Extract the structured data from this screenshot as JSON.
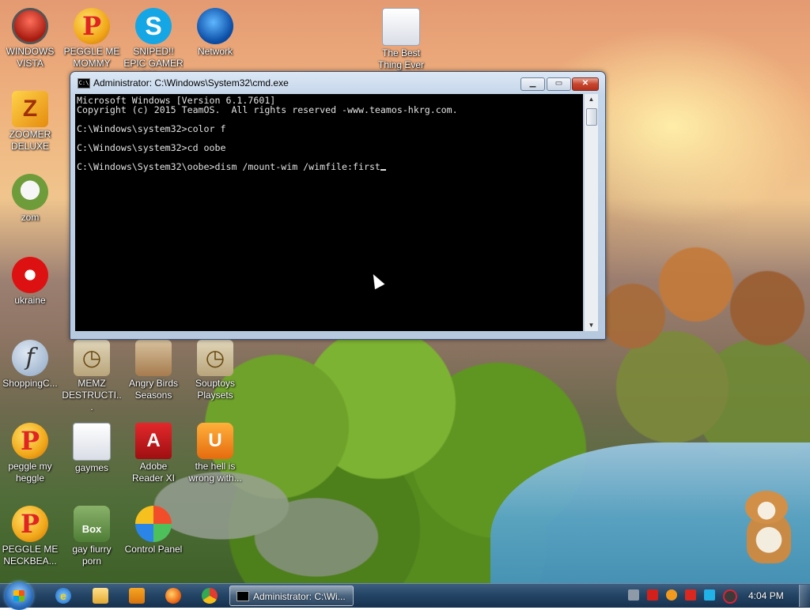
{
  "desktop_icons": [
    {
      "label": "WINDOWS VISTA",
      "icon": "vista-icon"
    },
    {
      "label": "PEGGLE ME MOMMY",
      "icon": "peggle-icon"
    },
    {
      "label": "SNIPED!! EPIC GAMER 360...",
      "icon": "skype-icon"
    },
    {
      "label": "Network",
      "icon": "network-icon"
    },
    {
      "label": "The Best Thing Ever",
      "icon": "folder-icon"
    },
    {
      "label": "ZOOMER DELUXE",
      "icon": "zoomer-icon"
    },
    {
      "label": "zom",
      "icon": "zom-icon"
    },
    {
      "label": "ukraine",
      "icon": "radiation-icon"
    },
    {
      "label": "ShoppingC...",
      "icon": "flash-icon"
    },
    {
      "label": "MEMZ DESTRUCTI...",
      "icon": "clock-icon"
    },
    {
      "label": "Angry Birds Seasons",
      "icon": "angry-birds-icon"
    },
    {
      "label": "Souptoys Playsets",
      "icon": "clock-icon"
    },
    {
      "label": "peggle my heggle",
      "icon": "peggle-icon"
    },
    {
      "label": "gaymes",
      "icon": "folder-icon"
    },
    {
      "label": "Adobe Reader XI",
      "icon": "pdf-icon"
    },
    {
      "label": "the hell is wrong with...",
      "icon": "uc-browser-icon"
    },
    {
      "label": "PEGGLE ME NECKBEA...",
      "icon": "peggle-icon"
    },
    {
      "label": "gay fiurry porn",
      "icon": "box-icon"
    },
    {
      "label": "Control Panel",
      "icon": "control-panel-icon"
    }
  ],
  "window": {
    "title": "Administrator: C:\\Windows\\System32\\cmd.exe",
    "title_icon_text": "C:\\",
    "console_lines": [
      "Microsoft Windows [Version 6.1.7601]",
      "Copyright (c) 2015 TeamOS.  All rights reserved -www.teamos-hkrg.com.",
      "",
      "C:\\Windows\\system32>color f",
      "",
      "C:\\Windows\\system32>cd oobe",
      "",
      "C:\\Windows\\System32\\oobe>dism /mount-wim /wimfile:first"
    ],
    "buttons": {
      "minimize": "minimize-icon",
      "maximize": "maximize-icon",
      "close": "close-icon"
    }
  },
  "taskbar": {
    "pinned": [
      "internet-explorer-icon",
      "folder-icon",
      "media-player-icon",
      "firefox-icon",
      "chrome-icon"
    ],
    "active_task": "Administrator: C:\\Wi...",
    "tray_icons": [
      "settings-icon",
      "antivirus-icon",
      "search-icon",
      "flag-icon",
      "display-icon",
      "speaker-icon"
    ],
    "clock": "4:04 PM"
  },
  "colors": {
    "console_bg": "#000000",
    "console_fg": "#e2e2e2",
    "taskbar": "#244566"
  }
}
